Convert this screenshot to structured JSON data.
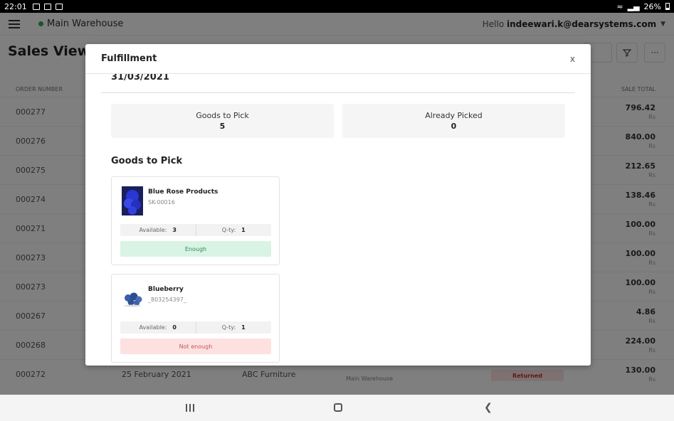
{
  "status_bar": {
    "time": "22:01",
    "battery": "26%"
  },
  "topbar": {
    "warehouse": "Main Warehouse",
    "hello_prefix": "Hello",
    "user": "indeewari.k@dearsystems.com"
  },
  "page": {
    "title": "Sales View"
  },
  "table": {
    "headers": {
      "order_number": "ORDER NUMBER",
      "sale_total": "SALE TOTAL"
    },
    "rows": [
      {
        "order": "000277",
        "total": "796.42",
        "currency": "Rs"
      },
      {
        "order": "000276",
        "total": "840.00",
        "currency": "Rs"
      },
      {
        "order": "000275",
        "total": "212.65",
        "currency": "Rs"
      },
      {
        "order": "000274",
        "total": "138.46",
        "currency": "Rs"
      },
      {
        "order": "000271",
        "total": "100.00",
        "currency": "Rs"
      },
      {
        "order": "000273",
        "total": "100.00",
        "currency": "Rs"
      },
      {
        "order": "000273",
        "total": "100.00",
        "currency": "Rs"
      },
      {
        "order": "000267",
        "total": "4.86",
        "currency": "Rs"
      },
      {
        "order": "000268",
        "total": "224.00",
        "currency": "Rs"
      },
      {
        "order": "000272",
        "total": "130.00",
        "currency": "Rs",
        "date": "25 February 2021",
        "customer": "ABC Furniture",
        "contact": "Main Warehouse",
        "status": "Returned"
      }
    ]
  },
  "modal": {
    "title": "Fulfillment",
    "close": "x",
    "date": "31/03/2021",
    "goods_to_pick": {
      "label": "Goods to Pick",
      "value": "5"
    },
    "already_picked": {
      "label": "Already Picked",
      "value": "0"
    },
    "section_title": "Goods to Pick",
    "products": [
      {
        "name": "Blue Rose Products",
        "sku": "SK-00016",
        "available_label": "Available:",
        "available": "3",
        "qty_label": "Q-ty:",
        "qty": "1",
        "status": "Enough"
      },
      {
        "name": "Blueberry",
        "sku": "_803254397_",
        "available_label": "Available:",
        "available": "0",
        "qty_label": "Q-ty:",
        "qty": "1",
        "status": "Not enough"
      }
    ]
  },
  "icons": {
    "menu": "hamburger-icon",
    "filter": "filter-icon",
    "more": "more-icon",
    "nav_recent": "recent-apps-icon",
    "nav_home": "home-icon",
    "nav_back": "back-icon"
  }
}
